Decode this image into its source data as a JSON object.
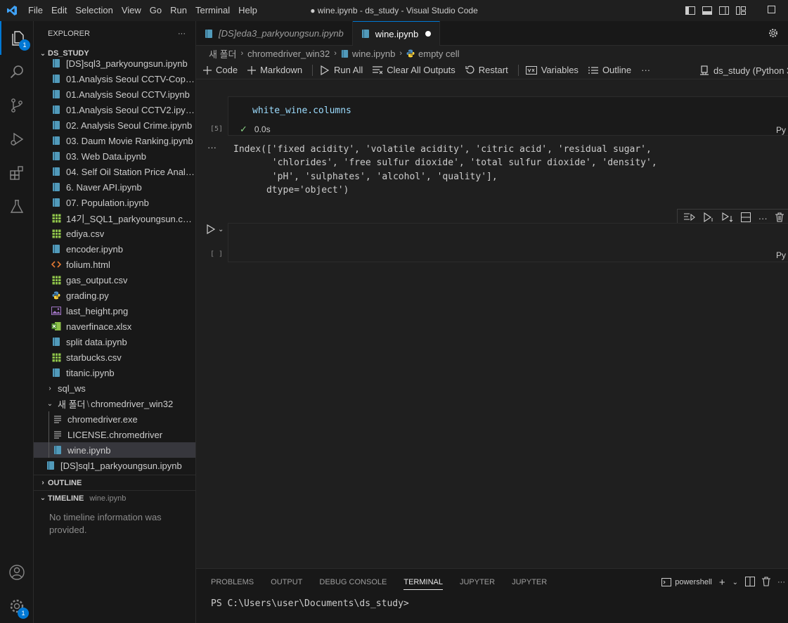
{
  "titlebar": {
    "menu": [
      "File",
      "Edit",
      "Selection",
      "View",
      "Go",
      "Run",
      "Terminal",
      "Help"
    ],
    "title": "● wine.ipynb - ds_study - Visual Studio Code"
  },
  "activitybar": {
    "explorer_badge": "1",
    "settings_badge": "1"
  },
  "sidebar": {
    "header": "EXPLORER",
    "more": "···",
    "root": "DS_STUDY",
    "files": [
      {
        "label": "[DS]sql3_parkyoungsun.ipynb",
        "icon": "notebook-icon"
      },
      {
        "label": "01.Analysis Seoul CCTV-Copy1....",
        "icon": "notebook-icon"
      },
      {
        "label": "01.Analysis Seoul CCTV.ipynb",
        "icon": "notebook-icon"
      },
      {
        "label": "01.Analysis Seoul CCTV2.ipynb",
        "icon": "notebook-icon"
      },
      {
        "label": "02. Analysis Seoul Crime.ipynb",
        "icon": "notebook-icon"
      },
      {
        "label": "03. Daum Movie Ranking.ipynb",
        "icon": "notebook-icon"
      },
      {
        "label": "03. Web Data.ipynb",
        "icon": "notebook-icon"
      },
      {
        "label": "04. Self Oil Station Price Analys...",
        "icon": "notebook-icon"
      },
      {
        "label": "6. Naver API.ipynb",
        "icon": "notebook-icon"
      },
      {
        "label": "07. Population.ipynb",
        "icon": "notebook-icon"
      },
      {
        "label": "14기_SQL1_parkyoungsun.csv.c...",
        "icon": "csv-icon"
      },
      {
        "label": "ediya.csv",
        "icon": "csv-icon"
      },
      {
        "label": "encoder.ipynb",
        "icon": "notebook-icon"
      },
      {
        "label": "folium.html",
        "icon": "html-icon"
      },
      {
        "label": "gas_output.csv",
        "icon": "csv-icon"
      },
      {
        "label": "grading.py",
        "icon": "python-icon"
      },
      {
        "label": "last_height.png",
        "icon": "image-icon"
      },
      {
        "label": "naverfinace.xlsx",
        "icon": "excel-icon"
      },
      {
        "label": "split data.ipynb",
        "icon": "notebook-icon"
      },
      {
        "label": "starbucks.csv",
        "icon": "csv-icon"
      },
      {
        "label": "titanic.ipynb",
        "icon": "notebook-icon"
      }
    ],
    "folder_sql_ws": "sql_ws",
    "folder_new": "새 폴더",
    "folder_new_sep": "\\",
    "folder_new_sub": "chromedriver_win32",
    "sub_files": [
      {
        "label": "chromedriver.exe",
        "icon": "file-lines-icon"
      },
      {
        "label": "LICENSE.chromedriver",
        "icon": "file-lines-icon"
      },
      {
        "label": "wine.ipynb",
        "icon": "notebook-icon"
      }
    ],
    "last_file": "[DS]sql1_parkyoungsun.ipynb",
    "outline": "OUTLINE",
    "timeline": "TIMELINE",
    "timeline_file": "wine.ipynb",
    "timeline_note": "No timeline information was provided."
  },
  "tabs": [
    {
      "label": "[DS]eda3_parkyoungsun.ipynb"
    },
    {
      "label": "wine.ipynb"
    }
  ],
  "breadcrumb": [
    "새 폴더",
    "chromedriver_win32",
    "wine.ipynb",
    "empty cell"
  ],
  "toolbar": {
    "code": "Code",
    "markdown": "Markdown",
    "run_all": "Run All",
    "clear_outputs": "Clear All Outputs",
    "restart": "Restart",
    "variables": "Variables",
    "outline": "Outline",
    "more": "···",
    "kernel": "ds_study (Python 3"
  },
  "cells": {
    "cell1": {
      "count": "[5]",
      "code": "white_wine.columns",
      "time": "0.0s",
      "lang": "Py"
    },
    "output_dots": "···",
    "output": "Index(['fixed acidity', 'volatile acidity', 'citric acid', 'residual sugar',\n       'chlorides', 'free sulfur dioxide', 'total sulfur dioxide', 'density',\n       'pH', 'sulphates', 'alcohol', 'quality'],\n      dtype='object')",
    "cell2": {
      "count": "[ ]",
      "lang": "Py"
    }
  },
  "panel": {
    "tabs": [
      "PROBLEMS",
      "OUTPUT",
      "DEBUG CONSOLE",
      "TERMINAL",
      "JUPYTER",
      "JUPYTER"
    ],
    "active_tab": "TERMINAL",
    "shell": "powershell",
    "prompt": "PS C:\\Users\\user\\Documents\\ds_study>"
  }
}
